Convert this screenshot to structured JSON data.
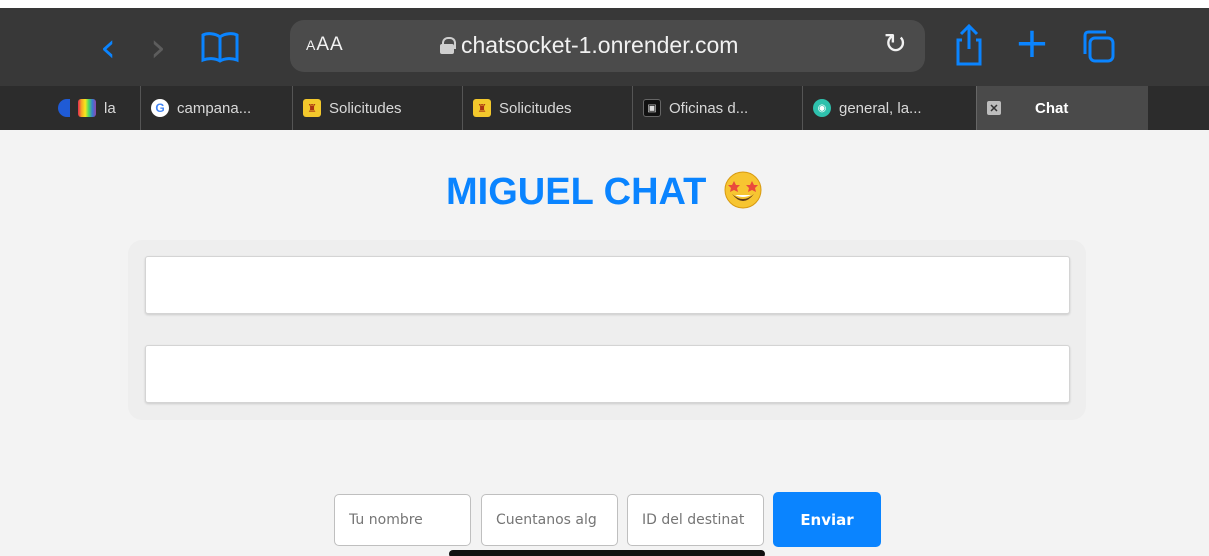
{
  "browser": {
    "aa_label": "AA",
    "url": "chatsocket-1.onrender.com",
    "tabs": [
      {
        "label": "la",
        "favicon": "rainbow-icon"
      },
      {
        "label": "campana...",
        "favicon": "google-icon"
      },
      {
        "label": "Solicitudes",
        "favicon": "spain-shield-icon"
      },
      {
        "label": "Solicitudes",
        "favicon": "spain-shield-icon"
      },
      {
        "label": "Oficinas d...",
        "favicon": "offices-icon"
      },
      {
        "label": "general, la...",
        "favicon": "general-icon"
      },
      {
        "label": "Chat",
        "favicon": "close-tab-icon",
        "active": true
      }
    ]
  },
  "page": {
    "title": "MIGUEL CHAT",
    "emoji": "star-struck-emoji",
    "inputs": {
      "name_placeholder": "Tu nombre",
      "message_placeholder": "Cuentanos alg",
      "recipient_placeholder": "ID del destinat"
    },
    "send_label": "Enviar"
  },
  "colors": {
    "accent": "#0a84ff",
    "browser_bg": "#383838",
    "tabbar_bg": "#2c2c2c",
    "page_bg": "#f3f3f3"
  }
}
